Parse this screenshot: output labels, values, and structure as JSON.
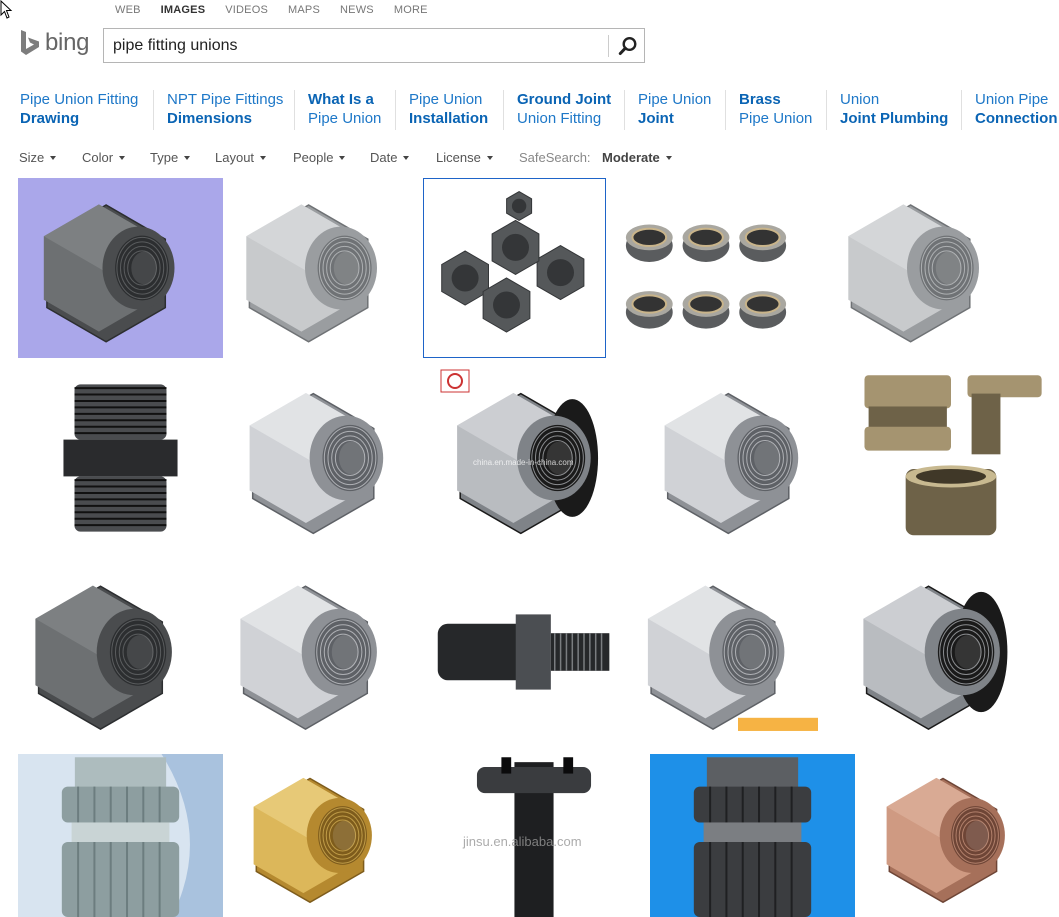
{
  "top_nav": [
    {
      "label": "WEB",
      "active": false
    },
    {
      "label": "IMAGES",
      "active": true
    },
    {
      "label": "VIDEOS",
      "active": false
    },
    {
      "label": "MAPS",
      "active": false
    },
    {
      "label": "NEWS",
      "active": false
    },
    {
      "label": "MORE",
      "active": false
    }
  ],
  "logo": {
    "wordmark": "bing",
    "icon": "bing-logo-icon"
  },
  "search": {
    "query": "pipe fitting unions",
    "button_icon": "search-icon"
  },
  "related_searches": [
    {
      "line1": "Pipe Union Fitting",
      "line2": "Drawing",
      "bold": 2
    },
    {
      "line1": "NPT Pipe Fittings",
      "line2": "Dimensions",
      "bold": 2
    },
    {
      "line1": "What Is a",
      "line2": "Pipe Union",
      "bold": 1
    },
    {
      "line1": "Pipe Union",
      "line2": "Installation",
      "bold": 2
    },
    {
      "line1": "Ground Joint",
      "line2": "Union Fitting",
      "bold": 1
    },
    {
      "line1": "Pipe Union",
      "line2": "Joint",
      "bold": 2
    },
    {
      "line1": "Brass",
      "line2": "Pipe Union",
      "bold": 1
    },
    {
      "line1": "Union",
      "line2": "Joint Plumbing",
      "bold": 2
    },
    {
      "line1": "Union Pipe",
      "line2": "Connection",
      "bold": 2
    }
  ],
  "filters": [
    "Size",
    "Color",
    "Type",
    "Layout",
    "People",
    "Date",
    "License"
  ],
  "safesearch": {
    "label": "SafeSearch:",
    "value": "Moderate"
  },
  "image_results": [
    {
      "subject": "dark steel union fitting on blue background",
      "style": "dark",
      "bg": "#aaa7ea"
    },
    {
      "subject": "galvanized hex union fitting",
      "style": "galv",
      "bg": "#ffffff"
    },
    {
      "subject": "group of five malleable iron unions",
      "style": "group",
      "bg": "#ffffff"
    },
    {
      "subject": "six union nut rings",
      "style": "rings",
      "bg": "#ffffff"
    },
    {
      "subject": "galvanized union with threaded bore",
      "style": "galv",
      "bg": "#ffffff"
    },
    {
      "subject": "black threaded hex nipple",
      "style": "nipple",
      "bg": "#ffffff"
    },
    {
      "subject": "stainless socket weld union",
      "style": "steel",
      "bg": "#ffffff"
    },
    {
      "subject": "union with black pipe end and watermark",
      "style": "blackend",
      "bg": "#ffffff"
    },
    {
      "subject": "small stainless threaded union",
      "style": "steel",
      "bg": "#ffffff"
    },
    {
      "subject": "brass nipple, tee and socket",
      "style": "brassset",
      "bg": "#ffffff"
    },
    {
      "subject": "dark malleable iron union",
      "style": "dark",
      "bg": "#ffffff"
    },
    {
      "subject": "polished stainless union",
      "style": "steel",
      "bg": "#ffffff"
    },
    {
      "subject": "black steel union with threaded spigot",
      "style": "blacklong",
      "bg": "#ffffff"
    },
    {
      "subject": "stainless union with orange watermark",
      "style": "steel",
      "bg": "#ffffff"
    },
    {
      "subject": "plastic and steel union",
      "style": "blackend",
      "bg": "#ffffff"
    },
    {
      "subject": "grey PVC union on blue wave background",
      "style": "pvcgrey",
      "bg": "#d8e4f0"
    },
    {
      "subject": "brass hex union",
      "style": "brass",
      "bg": "#ffffff"
    },
    {
      "subject": "black HDPE electrofusion tee",
      "style": "hdpe",
      "bg": "#ffffff"
    },
    {
      "subject": "grey PVC union on blue background",
      "style": "pvcdark",
      "bg": "#1e90e8"
    },
    {
      "subject": "bronze union fitting",
      "style": "bronze",
      "bg": "#ffffff"
    }
  ],
  "watermarks": {
    "t8": "china.en.made-in-china.com",
    "t18": "jinsu.en.alibaba.com"
  }
}
